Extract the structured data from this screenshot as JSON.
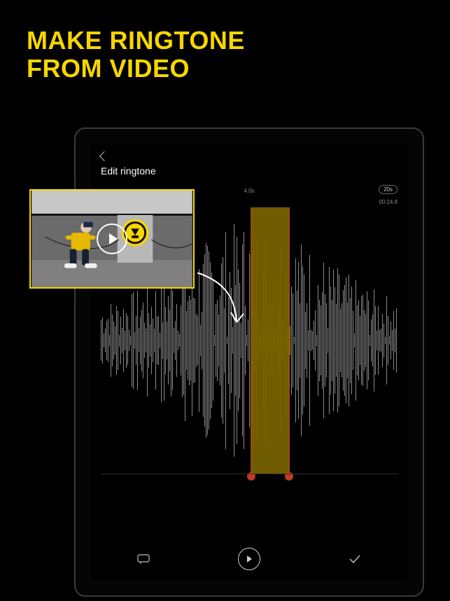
{
  "headline": "MAKE RINGTONE\nFROM VIDEO",
  "header": {
    "title": "Edit ringtone",
    "back_label": "Back"
  },
  "timeline": {
    "center_marker": "4.0s",
    "duration_badge": "20s",
    "end_time": "00:24.8"
  },
  "controls": {
    "loop_label": "Loop",
    "play_label": "Play",
    "confirm_label": "Confirm"
  },
  "video_thumb": {
    "play_label": "Play video"
  },
  "colors": {
    "accent": "#F7D600",
    "selection": "#7a6400",
    "handle": "#d04028"
  }
}
